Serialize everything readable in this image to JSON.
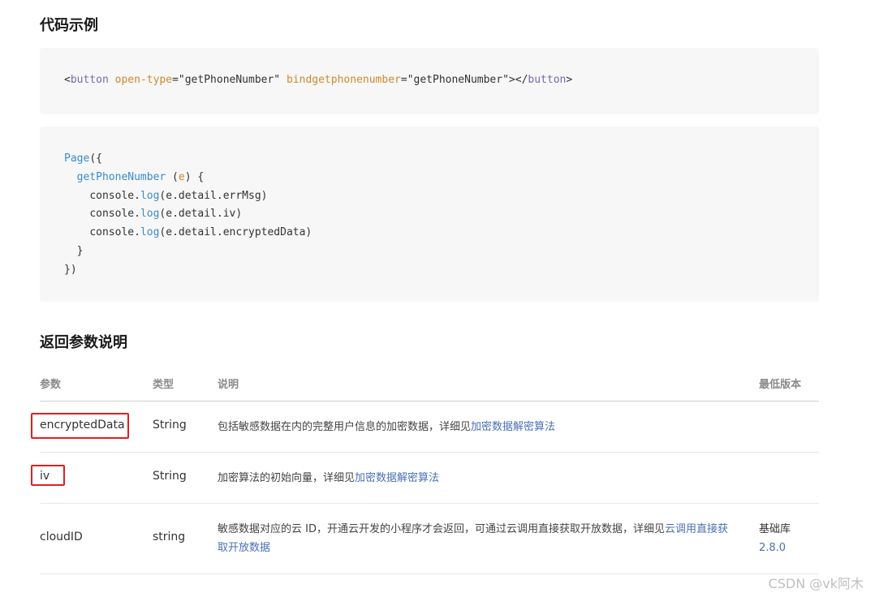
{
  "section_code": {
    "title": "代码示例"
  },
  "code1": {
    "lt": "<",
    "tag_open": "button",
    "attr1": "open-type",
    "eq1": "=",
    "val1": "\"getPhoneNumber\"",
    "attr2": "bindgetphonenumber",
    "eq2": "=",
    "val2": "\"getPhoneNumber\"",
    "mid": "></",
    "tag_close": "button",
    "gt": ">"
  },
  "code2": {
    "l1_kw": "Page",
    "l1_rest": "({",
    "l2_kw": "getPhoneNumber",
    "l2_sp": " (",
    "l2_param": "e",
    "l2_rest": ") {",
    "l3_a": "console.",
    "l3_fn": "log",
    "l3_b": "(e.detail.errMsg)",
    "l4_a": "console.",
    "l4_fn": "log",
    "l4_b": "(e.detail.iv)",
    "l5_a": "console.",
    "l5_fn": "log",
    "l5_b": "(e.detail.encryptedData)",
    "l6": "}",
    "l7": "})"
  },
  "section_params": {
    "title": "返回参数说明"
  },
  "table": {
    "headers": {
      "param": "参数",
      "type": "类型",
      "desc": "说明",
      "version": "最低版本"
    },
    "rows": [
      {
        "param": "encryptedData",
        "type": "String",
        "desc_text": "包括敏感数据在内的完整用户信息的加密数据，详细见",
        "desc_link": "加密数据解密算法",
        "version": ""
      },
      {
        "param": "iv",
        "type": "String",
        "desc_text": "加密算法的初始向量，详细见",
        "desc_link": "加密数据解密算法",
        "version": ""
      },
      {
        "param": "cloudID",
        "type": "string",
        "desc_text": "敏感数据对应的云 ID，开通云开发的小程序才会返回，可通过云调用直接获取开放数据，详细见",
        "desc_link": "云调用直接获取开放数据",
        "version_label": "基础库",
        "version_value": "2.8.0"
      }
    ]
  },
  "watermark": "CSDN @vk阿木",
  "colors": {
    "highlight_box": "#e02020",
    "link": "#4a6fb5",
    "code_bg": "#f7f7f7"
  }
}
